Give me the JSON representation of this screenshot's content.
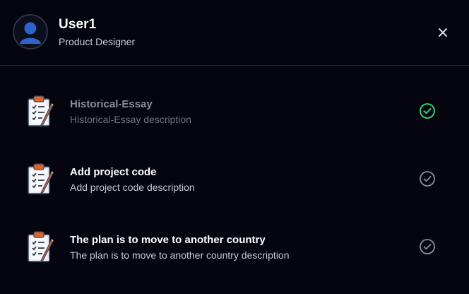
{
  "user": {
    "name": "User1",
    "role": "Product Designer"
  },
  "tasks": [
    {
      "title": "Historical-Essay",
      "description": "Historical-Essay description",
      "completed": true
    },
    {
      "title": "Add project code",
      "description": "Add project code description",
      "completed": false
    },
    {
      "title": "The plan is to move to another country",
      "description": "The plan is to move to another country description",
      "completed": false
    }
  ],
  "colors": {
    "background": "#05050f",
    "completed_check": "#3ddc84",
    "pending_check": "#8a8d96",
    "accent": "#e0622f"
  },
  "icons": {
    "avatar": "user-avatar-icon",
    "close": "close-icon",
    "task": "clipboard-checklist-icon",
    "status": "check-circle-icon"
  }
}
